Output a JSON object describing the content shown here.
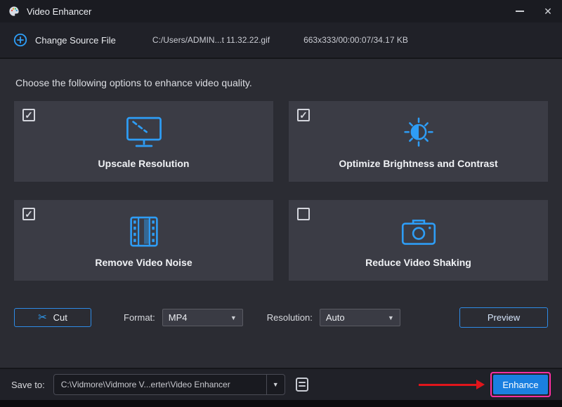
{
  "window": {
    "title": "Video Enhancer"
  },
  "icons": {
    "close": "✕",
    "scissors": "✂",
    "caret": "▼"
  },
  "source": {
    "change_label": "Change Source File",
    "file_path": "C:/Users/ADMIN...t 11.32.22.gif",
    "file_info": "663x333/00:00:07/34.17 KB"
  },
  "main": {
    "instruction": "Choose the following options to enhance video quality."
  },
  "options": [
    {
      "label": "Upscale Resolution",
      "checked": true,
      "icon": "upscale-monitor-icon"
    },
    {
      "label": "Optimize Brightness and Contrast",
      "checked": true,
      "icon": "brightness-contrast-icon"
    },
    {
      "label": "Remove Video Noise",
      "checked": true,
      "icon": "filmstrip-icon"
    },
    {
      "label": "Reduce Video Shaking",
      "checked": false,
      "icon": "camera-icon"
    }
  ],
  "controls": {
    "cut_label": "Cut",
    "format_label": "Format:",
    "format_value": "MP4",
    "resolution_label": "Resolution:",
    "resolution_value": "Auto",
    "preview_label": "Preview"
  },
  "footer": {
    "save_to_label": "Save to:",
    "save_path": "C:\\Vidmore\\Vidmore V...erter\\Video Enhancer",
    "enhance_label": "Enhance"
  },
  "colors": {
    "accent_blue": "#2e9df5",
    "button_blue": "#1a7fe0",
    "annotation_red": "#e0151b",
    "annotation_pink": "#ff2fa2"
  }
}
